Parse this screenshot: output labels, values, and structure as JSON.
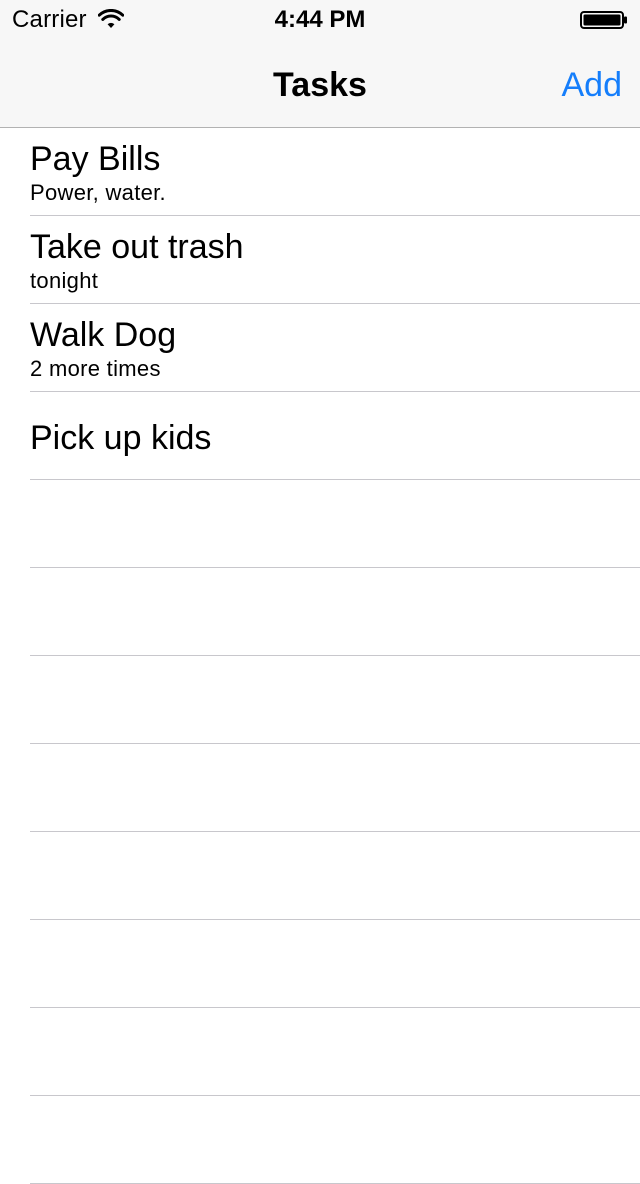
{
  "status_bar": {
    "carrier": "Carrier",
    "time": "4:44 PM",
    "wifi_icon": "wifi-icon",
    "battery_icon": "battery-full-icon"
  },
  "nav": {
    "title": "Tasks",
    "add_label": "Add"
  },
  "tasks": [
    {
      "title": "Pay Bills",
      "subtitle": "Power, water."
    },
    {
      "title": "Take out trash",
      "subtitle": "tonight"
    },
    {
      "title": "Walk Dog",
      "subtitle": "2 more times"
    },
    {
      "title": "Pick up kids",
      "subtitle": ""
    }
  ],
  "colors": {
    "tint": "#157efb",
    "nav_background": "#f7f7f7",
    "separator": "#c8c7cc"
  }
}
